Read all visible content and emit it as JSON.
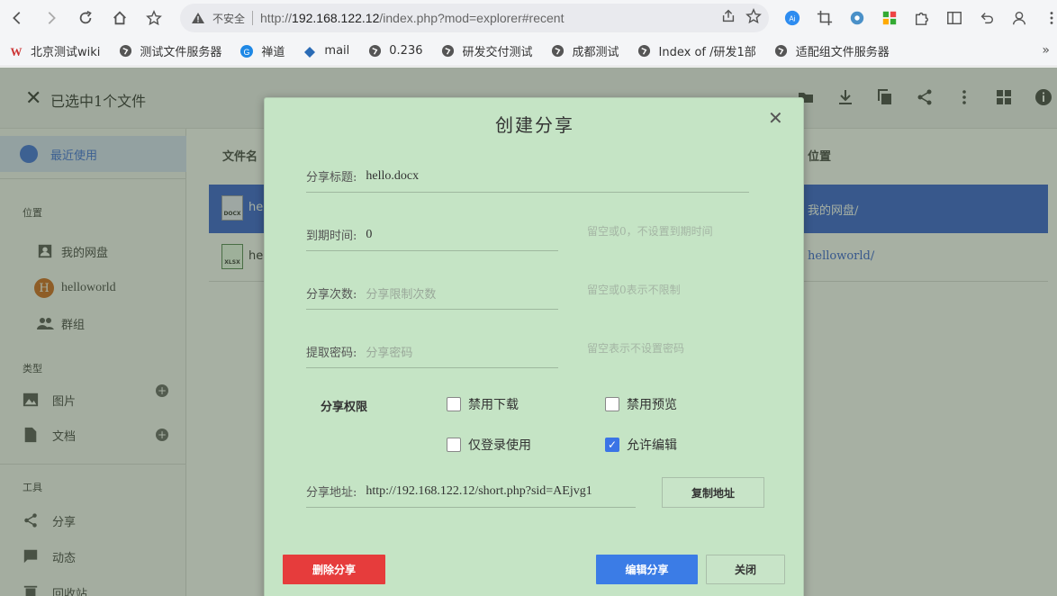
{
  "browser": {
    "insecure_label": "不安全",
    "url_prefix": "http://",
    "url_host": "192.168.122.12",
    "url_path": "/index.php?mod=explorer#recent",
    "bookmarks": [
      {
        "label": "北京测试wiki",
        "icon": "wiki-icon"
      },
      {
        "label": "测试文件服务器",
        "icon": "globe-icon"
      },
      {
        "label": "禅道",
        "icon": "zentao-icon"
      },
      {
        "label": "mail",
        "icon": "mail-icon"
      },
      {
        "label": "0.236",
        "icon": "globe-icon"
      },
      {
        "label": "研发交付测试",
        "icon": "globe-icon"
      },
      {
        "label": "成都测试",
        "icon": "globe-icon"
      },
      {
        "label": "Index of /研发1部",
        "icon": "globe-icon"
      },
      {
        "label": "适配组文件服务器",
        "icon": "globe-icon"
      }
    ]
  },
  "app": {
    "selection_text": "已选中1个文件",
    "sidebar": {
      "recent": "最近使用",
      "location_head": "位置",
      "my_disk": "我的网盘",
      "helloworld": "helloworld",
      "group": "群组",
      "avatar_letter": "H",
      "type_head": "类型",
      "images": "图片",
      "docs": "文档",
      "tools_head": "工具",
      "share": "分享",
      "activity": "动态",
      "recycle": "回收站"
    },
    "table": {
      "col_name": "文件名",
      "col_location": "位置",
      "rows": [
        {
          "name": "hel",
          "ext": "DOCX",
          "location": "我的网盘/",
          "selected": true
        },
        {
          "name": "hel",
          "ext": "XLSX",
          "location": "helloworld/",
          "selected": false
        }
      ]
    }
  },
  "dialog": {
    "title": "创建分享",
    "share_title_label": "分享标题:",
    "share_title_value": "hello.docx",
    "expire_label": "到期时间:",
    "expire_value": "0",
    "expire_hint": "留空或0，不设置到期时间",
    "count_label": "分享次数:",
    "count_placeholder": "分享限制次数",
    "count_hint": "留空或0表示不限制",
    "password_label": "提取密码:",
    "password_placeholder": "分享密码",
    "password_hint": "留空表示不设置密码",
    "perm_label": "分享权限",
    "opt_no_download": "禁用下载",
    "opt_no_preview": "禁用预览",
    "opt_login_only": "仅登录使用",
    "opt_allow_edit": "允许编辑",
    "opt_allow_edit_checked": true,
    "link_label": "分享地址:",
    "link_value": "http://192.168.122.12/short.php?sid=AEjvg1",
    "copy_label": "复制地址",
    "delete_label": "删除分享",
    "edit_label": "编辑分享",
    "close_label": "关闭"
  }
}
